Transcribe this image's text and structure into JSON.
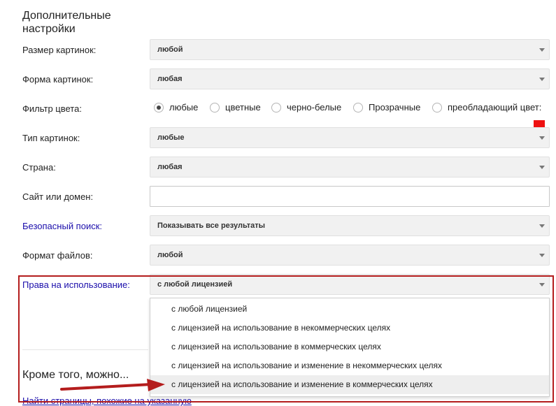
{
  "section_title": "Дополнительные настройки",
  "labels": {
    "size": "Размер картинок:",
    "shape": "Форма картинок:",
    "color": "Фильтр цвета:",
    "type": "Тип картинок:",
    "country": "Страна:",
    "site": "Сайт или домен:",
    "safe": "Безопасный поиск:",
    "format": "Формат файлов:",
    "rights": "Права на использование:"
  },
  "selects": {
    "size": "любой",
    "shape": "любая",
    "type": "любые",
    "country": "любая",
    "safe": "Показывать все результаты",
    "format": "любой",
    "rights": "с любой лицензией"
  },
  "color_filter": {
    "selected": "любые",
    "options": [
      "любые",
      "цветные",
      "черно-белые",
      "Прозрачные",
      "преобладающий цвет:"
    ],
    "swatch_color": "#ee1111"
  },
  "site_input_value": "",
  "rights_options": [
    "с любой лицензией",
    "с лицензией на использование в некоммерческих целях",
    "с лицензией на использование в коммерческих целях",
    "с лицензией на использование и изменение в некоммерческих целях",
    "с лицензией на использование и изменение в коммерческих целях"
  ],
  "more": {
    "heading": "Кроме того, можно...",
    "link": "Найти страницы, похожие на указанную"
  },
  "colors": {
    "annotation": "#b41d1d",
    "link": "#1a0dab"
  }
}
